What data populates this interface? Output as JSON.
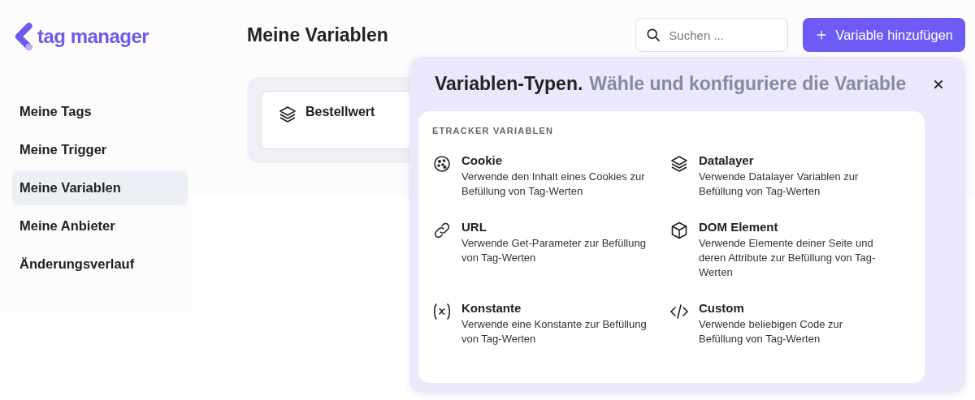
{
  "logo": {
    "text": "tag manager"
  },
  "sidebar": {
    "items": [
      {
        "label": "Meine Tags",
        "selected": false
      },
      {
        "label": "Meine Trigger",
        "selected": false
      },
      {
        "label": "Meine Variablen",
        "selected": true
      },
      {
        "label": "Meine Anbieter",
        "selected": false
      },
      {
        "label": "Änderungsverlauf",
        "selected": false
      }
    ]
  },
  "page_title": "Meine Variablen",
  "search": {
    "placeholder": "Suchen ..."
  },
  "add_button": {
    "label": "Variable hinzufügen"
  },
  "variables": [
    {
      "name": "Bestellwert",
      "kind": "layers"
    }
  ],
  "popover": {
    "title": "Variablen-Typen.",
    "subtitle": "Wähle und konfiguriere die Variable",
    "section_label": "ETRACKER VARIABLEN",
    "types": [
      {
        "kind": "cookie",
        "title": "Cookie",
        "description": "Verwende den Inhalt eines Cookies zur Befüllung von Tag-Werten"
      },
      {
        "kind": "layers",
        "title": "Datalayer",
        "description": "Verwende Datalayer Variablen zur Befüllung von Tag-Werten"
      },
      {
        "kind": "link",
        "title": "URL",
        "description": "Verwende Get-Parameter zur Befüllung von Tag-Werten"
      },
      {
        "kind": "cube",
        "title": "DOM Element",
        "description": "Verwende Elemente deiner Seite und deren Attribute zur Befüllung von Tag-Werten"
      },
      {
        "kind": "variable",
        "title": "Konstante",
        "description": "Verwende eine Konstante zur Befüllung von Tag-Werten"
      },
      {
        "kind": "code",
        "title": "Custom",
        "description": "Verwende beliebigen Code zur Befüllung von Tag-Werten"
      }
    ]
  }
}
